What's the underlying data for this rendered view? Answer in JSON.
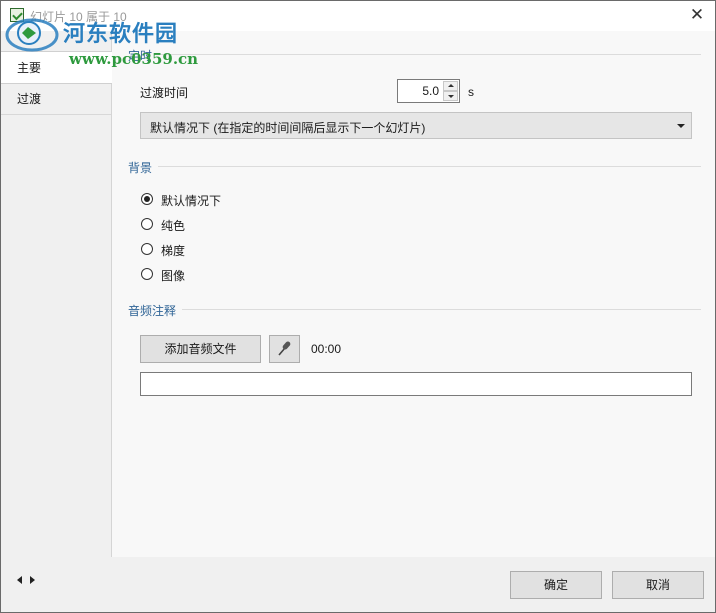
{
  "window": {
    "title": "幻灯片 10 属于 10",
    "close_glyph": "✕"
  },
  "watermark": {
    "name": "河东软件园",
    "url": "www.pc0359.cn"
  },
  "sidebar": {
    "items": [
      {
        "label": "主要",
        "active": true
      },
      {
        "label": "过渡",
        "active": false
      }
    ]
  },
  "timing": {
    "section": "定时",
    "transition_label": "过渡时间",
    "transition_value": "5.0",
    "unit": "s",
    "mode_selected": "默认情况下 (在指定的时间间隔后显示下一个幻灯片)"
  },
  "background": {
    "section": "背景",
    "options": [
      {
        "label": "默认情况下",
        "checked": true
      },
      {
        "label": "纯色",
        "checked": false
      },
      {
        "label": "梯度",
        "checked": false
      },
      {
        "label": "图像",
        "checked": false
      }
    ]
  },
  "audio": {
    "section": "音频注释",
    "add_button": "添加音频文件",
    "mic_icon": "microphone-icon",
    "time": "00:00",
    "field_value": ""
  },
  "footer": {
    "ok": "确定",
    "cancel": "取消"
  }
}
